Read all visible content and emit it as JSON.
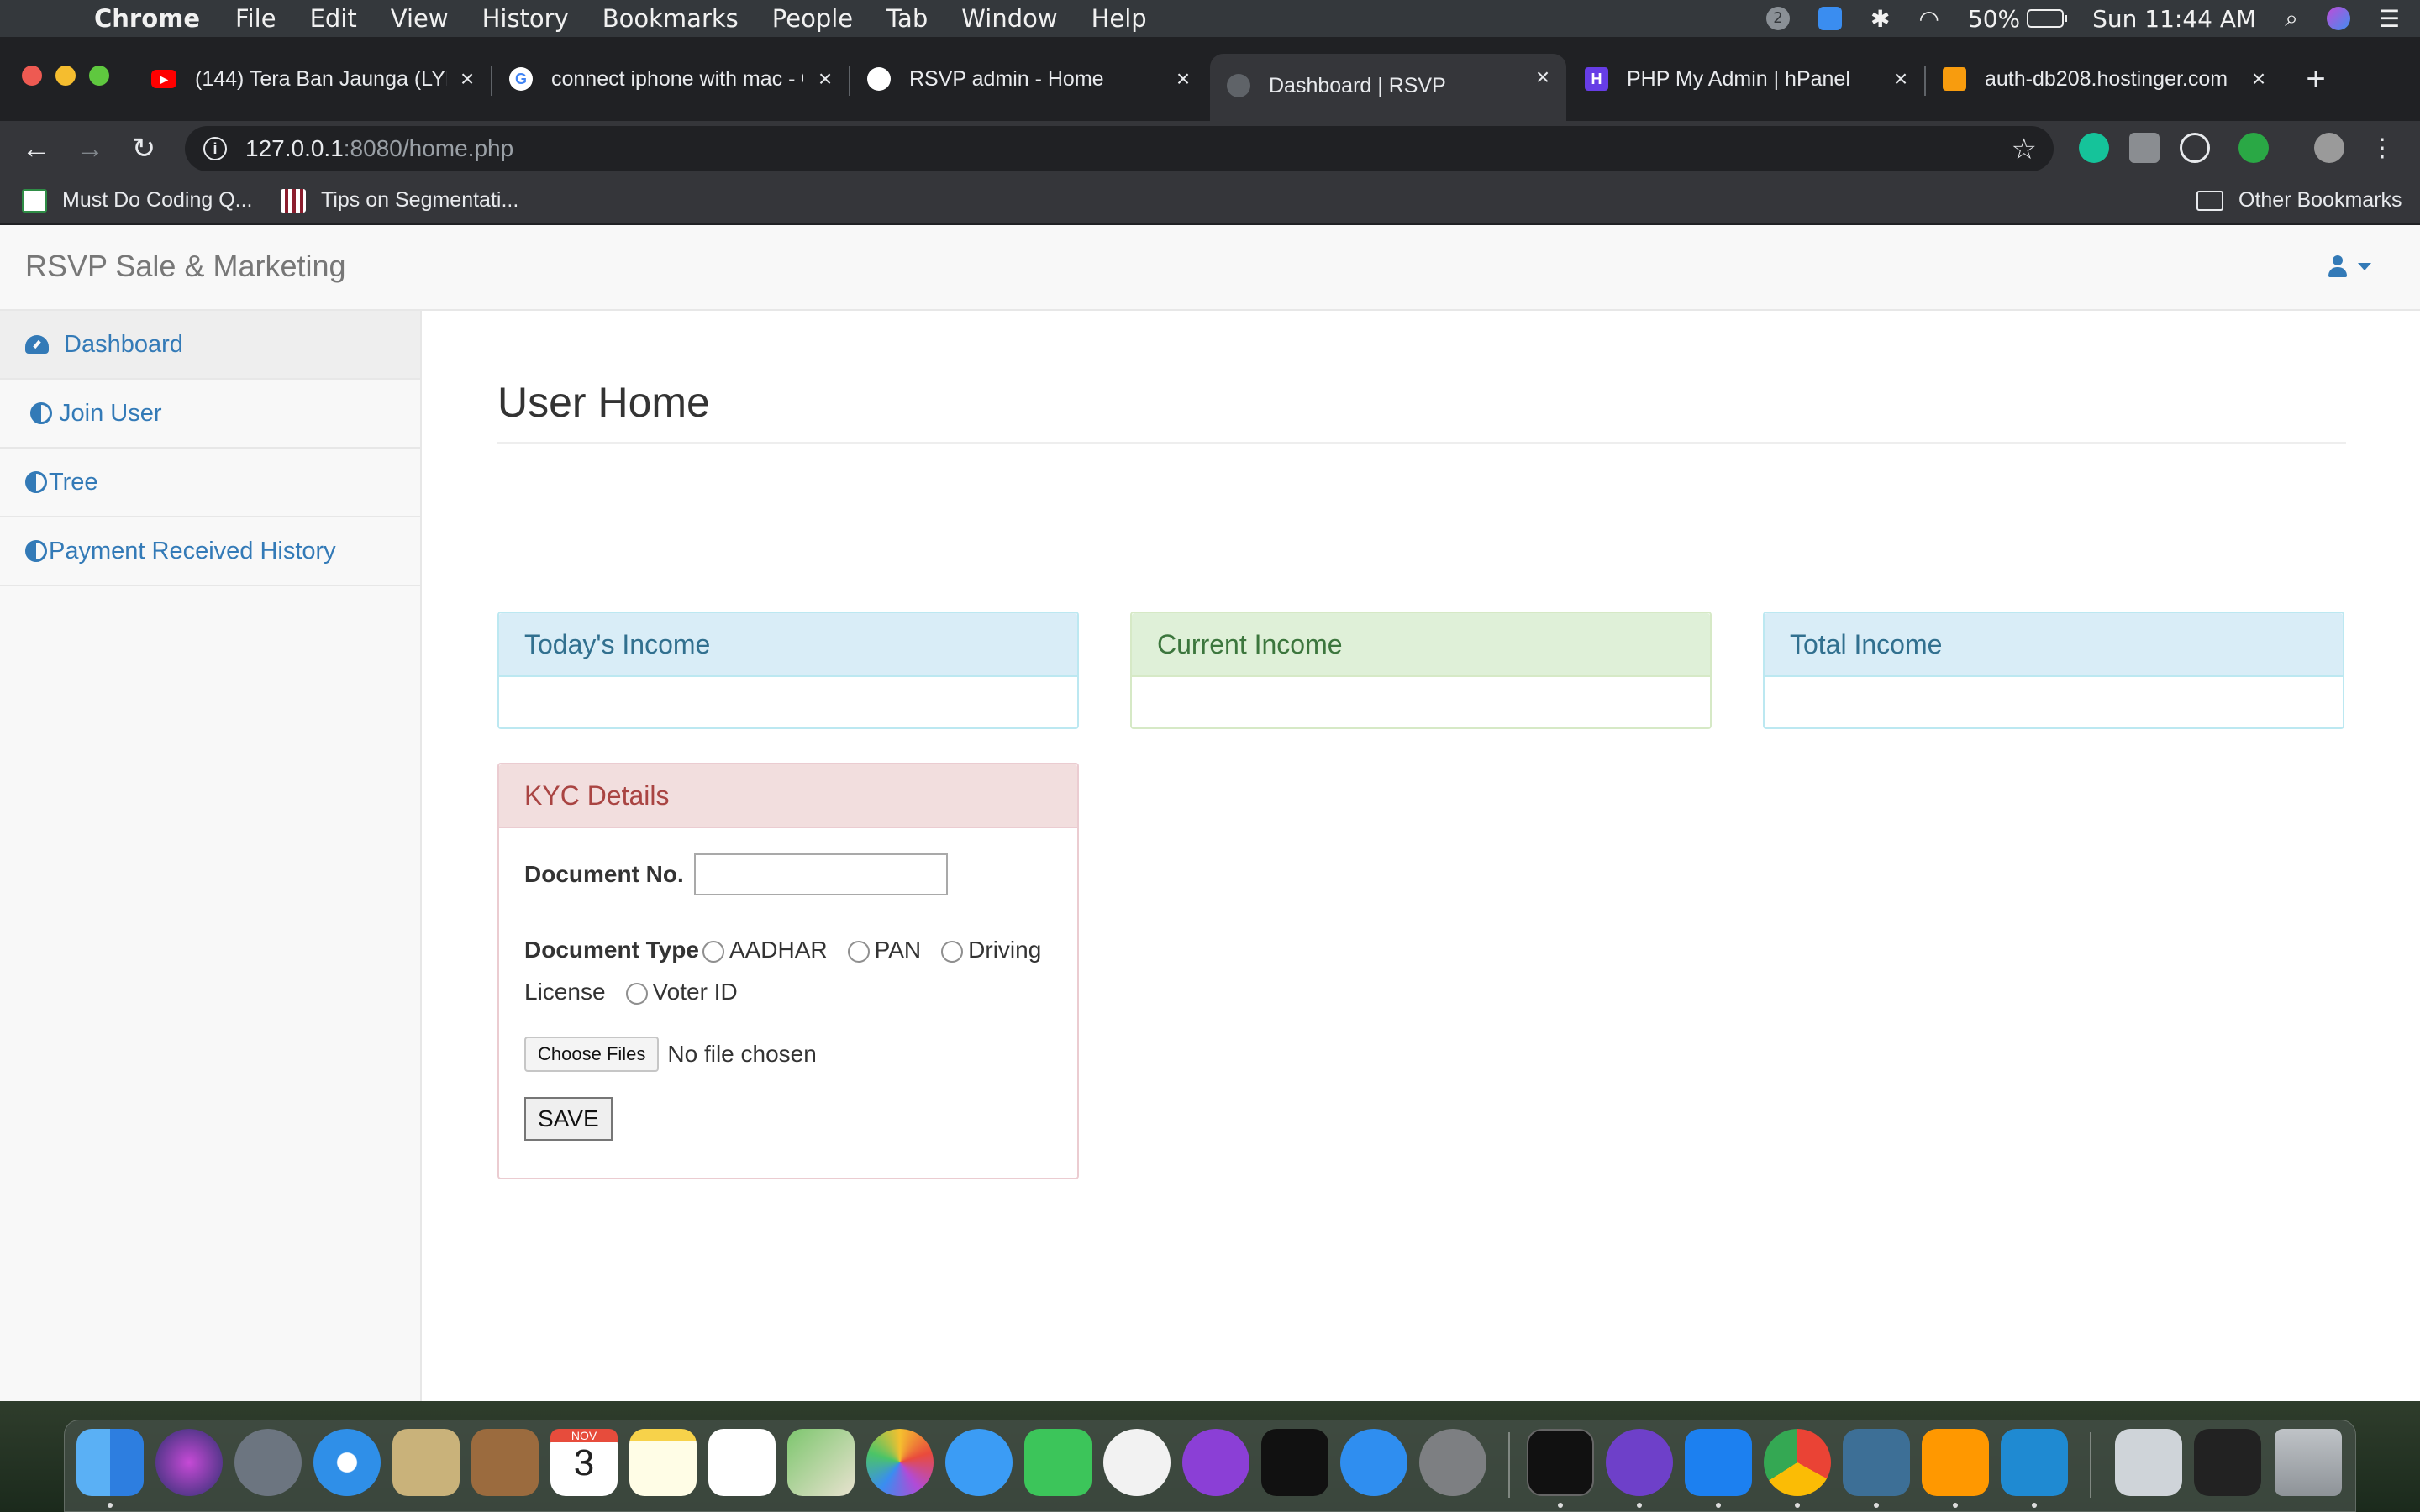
{
  "menubar": {
    "app": "Chrome",
    "menus": [
      "File",
      "Edit",
      "View",
      "History",
      "Bookmarks",
      "People",
      "Tab",
      "Window",
      "Help"
    ],
    "badge": "2",
    "battery": "50%",
    "clock": "Sun 11:44 AM"
  },
  "tabs": [
    {
      "title": "(144) Tera Ban Jaunga (LYR",
      "favicon": "youtube-icon",
      "color": "#ff0000"
    },
    {
      "title": "connect iphone with mac - G",
      "favicon": "google-icon",
      "color": "#ffffff"
    },
    {
      "title": "RSVP admin - Home",
      "favicon": "globe-icon",
      "color": "#ffffff"
    },
    {
      "title": "Dashboard | RSVP",
      "favicon": "globe-icon",
      "color": "#5f6368",
      "active": true
    },
    {
      "title": "PHP My Admin | hPanel",
      "favicon": "hostinger-icon",
      "color": "#673de6"
    },
    {
      "title": "auth-db208.hostinger.com",
      "favicon": "phpmyadmin-icon",
      "color": "#f89c0e"
    }
  ],
  "address": {
    "host": "127.0.0.1",
    "rest": ":8080/home.php"
  },
  "bookmarks": {
    "items": [
      "Must Do Coding Q...",
      "Tips on Segmentati..."
    ],
    "other": "Other Bookmarks"
  },
  "page": {
    "brand": "RSVP Sale & Marketing",
    "sidebar": [
      "Dashboard",
      "Join User",
      "Tree",
      "Payment Received History"
    ],
    "title": "User Home",
    "panels": {
      "today": "Today's Income",
      "current": "Current Income",
      "total": "Total Income"
    },
    "kyc": {
      "heading": "KYC Details",
      "doc_no_label": "Document No.",
      "doc_type_label": "Document Type",
      "options": [
        "AADHAR",
        "PAN",
        "Driving License",
        "Voter ID"
      ],
      "choose_files": "Choose Files",
      "no_file": "No file chosen",
      "save": "SAVE"
    }
  },
  "calendar": {
    "month": "NOV",
    "day": "3"
  },
  "colors": {
    "link": "#337ab7",
    "info_bg": "#d9edf7",
    "success_bg": "#dff0d8",
    "danger_bg": "#f2dede"
  }
}
